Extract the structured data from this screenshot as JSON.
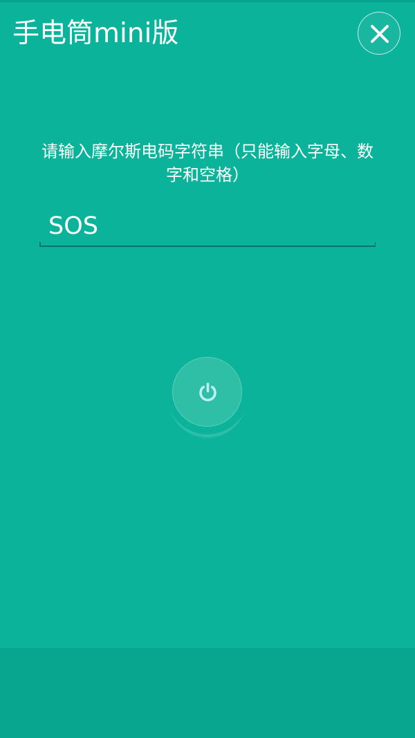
{
  "header": {
    "title": "手电筒mini版",
    "close_icon": "close-icon"
  },
  "morse": {
    "instruction": "请输入摩尔斯电码字符串（只能输入字母、数字和空格）",
    "value": "SOS"
  },
  "power": {
    "icon": "power-icon"
  },
  "colors": {
    "background": "#0bb39b",
    "bottom_bar": "#09a68f",
    "underline": "#067566",
    "power_button": "#2fbfa7",
    "power_icon": "#bfeff6"
  }
}
